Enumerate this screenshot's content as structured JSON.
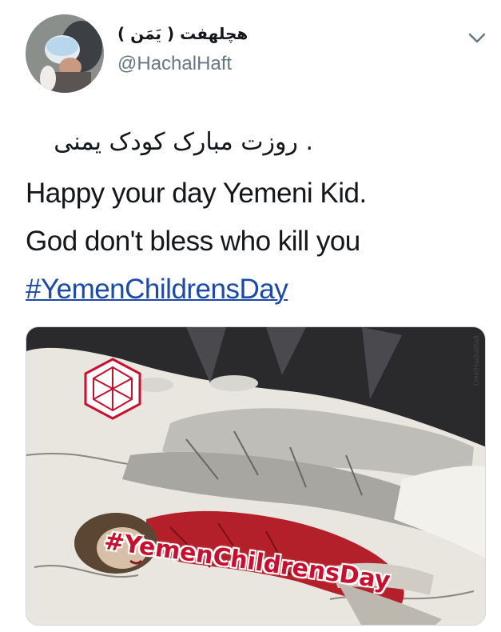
{
  "account": {
    "display_name": "هچلهفت ( یَمَن )",
    "handle": "@HachalHaft",
    "avatar": "profile-photo"
  },
  "tweet": {
    "rtl_line": ". روزت مبارک کودک یمنی",
    "line1": "Happy your day Yemeni Kid.",
    "line2": "God don't bless who kill you",
    "hashtag": "#YemenChildrensDay"
  },
  "media": {
    "overlay_tag": "#YemenChildrensDay",
    "watermark": "t.me/Hachalhaft",
    "logo": "red-geometric-logo"
  },
  "icons": {
    "menu": "chevron-down-icon"
  },
  "colors": {
    "text": "#14171a",
    "secondary": "#657786",
    "link": "#1b4aa8",
    "overlay_red": "#c8102e"
  }
}
